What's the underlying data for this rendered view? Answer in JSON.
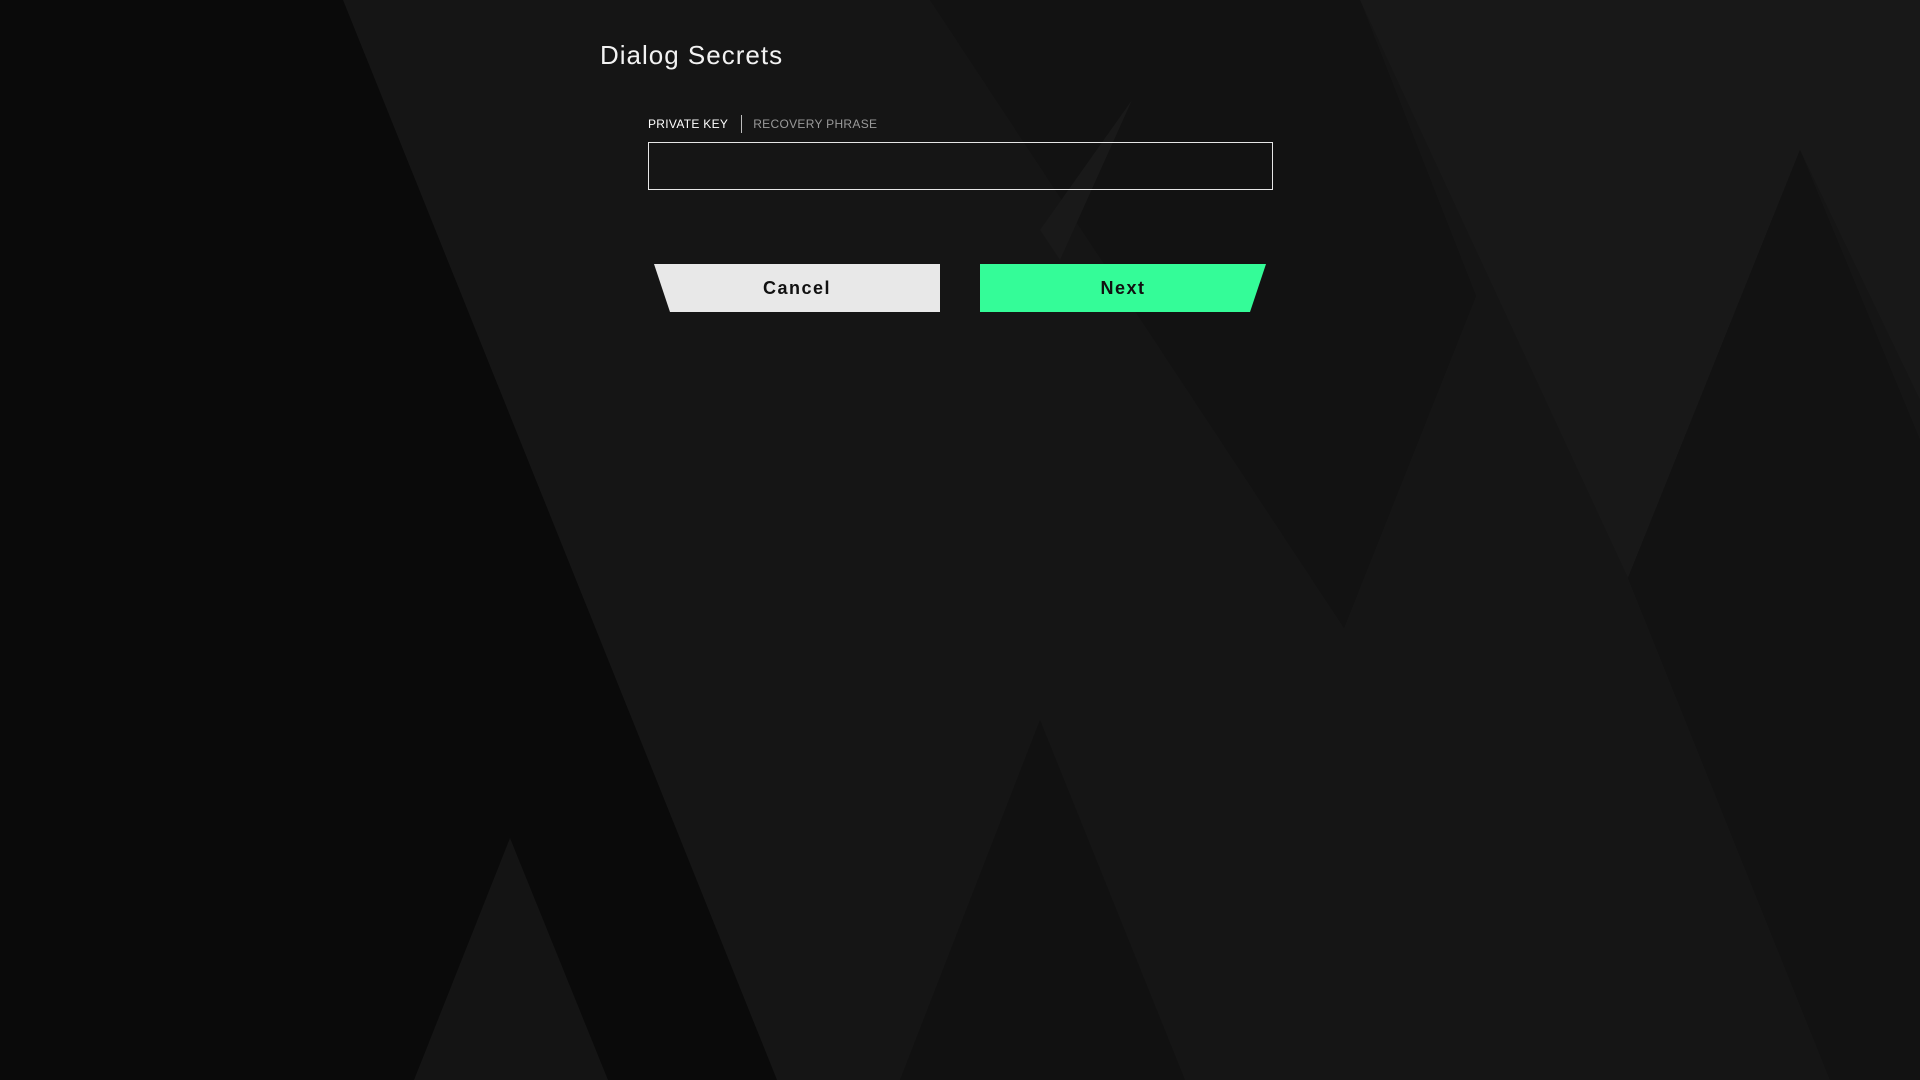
{
  "dialog": {
    "title": "Dialog Secrets"
  },
  "tabs": [
    {
      "label": "PRIVATE KEY",
      "active": true
    },
    {
      "label": "RECOVERY PHRASE",
      "active": false
    }
  ],
  "secret_input": {
    "value": "",
    "placeholder": ""
  },
  "buttons": {
    "cancel_label": "Cancel",
    "next_label": "Next"
  },
  "colors": {
    "accent": "#34fc98",
    "background": "#141414",
    "secondary_button": "#e8e8e8"
  }
}
